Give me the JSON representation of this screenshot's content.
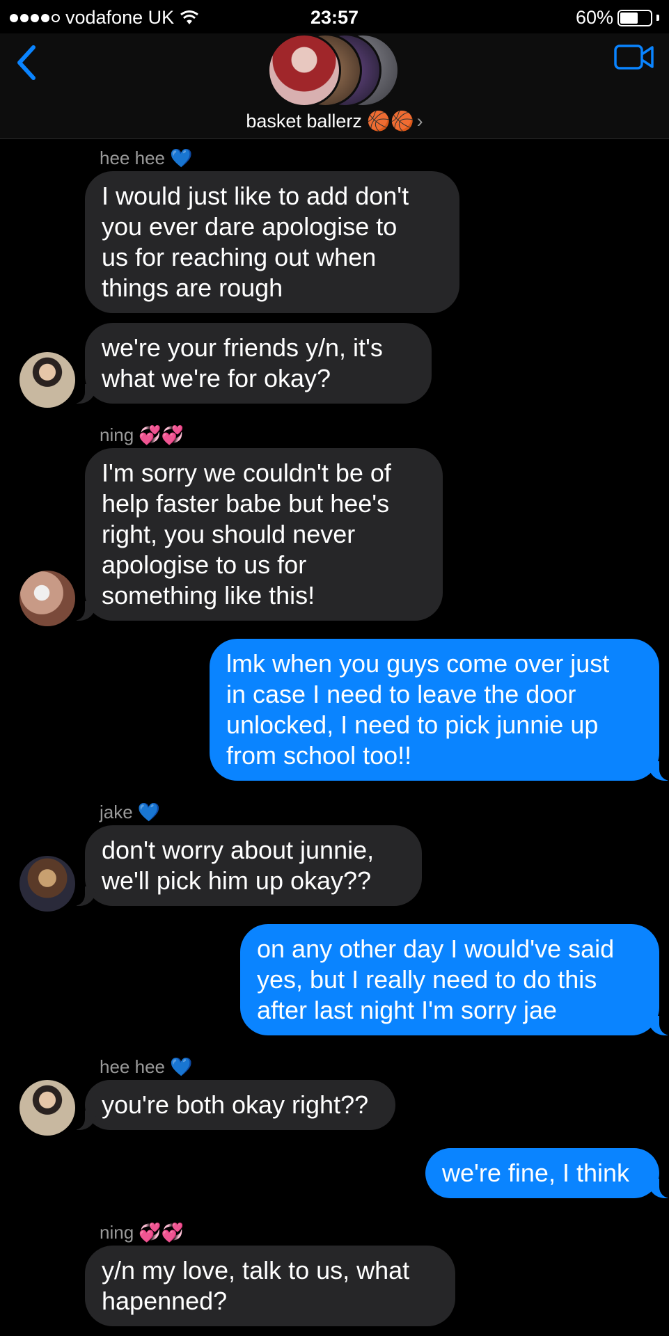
{
  "status_bar": {
    "carrier": "vodafone UK",
    "time": "23:57",
    "battery_percent": "60%",
    "battery_level": 0.6
  },
  "header": {
    "group_name": "basket ballerz 🏀🏀",
    "chevron": "›",
    "icons": {
      "back": "chevron-left-icon",
      "video": "video-camera-icon"
    },
    "accent_color": "#0a84ff"
  },
  "messages": [
    {
      "sender": "hee hee 💙"
    },
    {
      "text": "I would just like to add don't\nyou ever dare apologise to\nus for reaching out when\nthings are rough"
    },
    {
      "text": "we're your friends y/n, it's\nwhat we're for okay?"
    },
    {
      "sender": "ning 💞💞"
    },
    {
      "text": "I'm sorry we couldn't be of\nhelp faster babe but hee's\nright, you should never\napologise to us for\nsomething like this!"
    },
    {
      "text": "lmk when you guys come over just\nin case I need to leave the door\nunlocked, I need to pick junnie up\nfrom school too!!"
    },
    {
      "sender": "jake 💙"
    },
    {
      "text": "don't worry about junnie,\nwe'll pick him up okay??"
    },
    {
      "text": "on any other day I would've said\nyes, but I really need to do this\nafter last night I'm sorry jae"
    },
    {
      "sender": "hee hee 💙"
    },
    {
      "text": "you're both okay right??"
    },
    {
      "text": "we're fine, I think"
    },
    {
      "sender": "ning 💞💞"
    },
    {
      "text": "y/n my love, talk to us, what\nhapenned?"
    }
  ]
}
